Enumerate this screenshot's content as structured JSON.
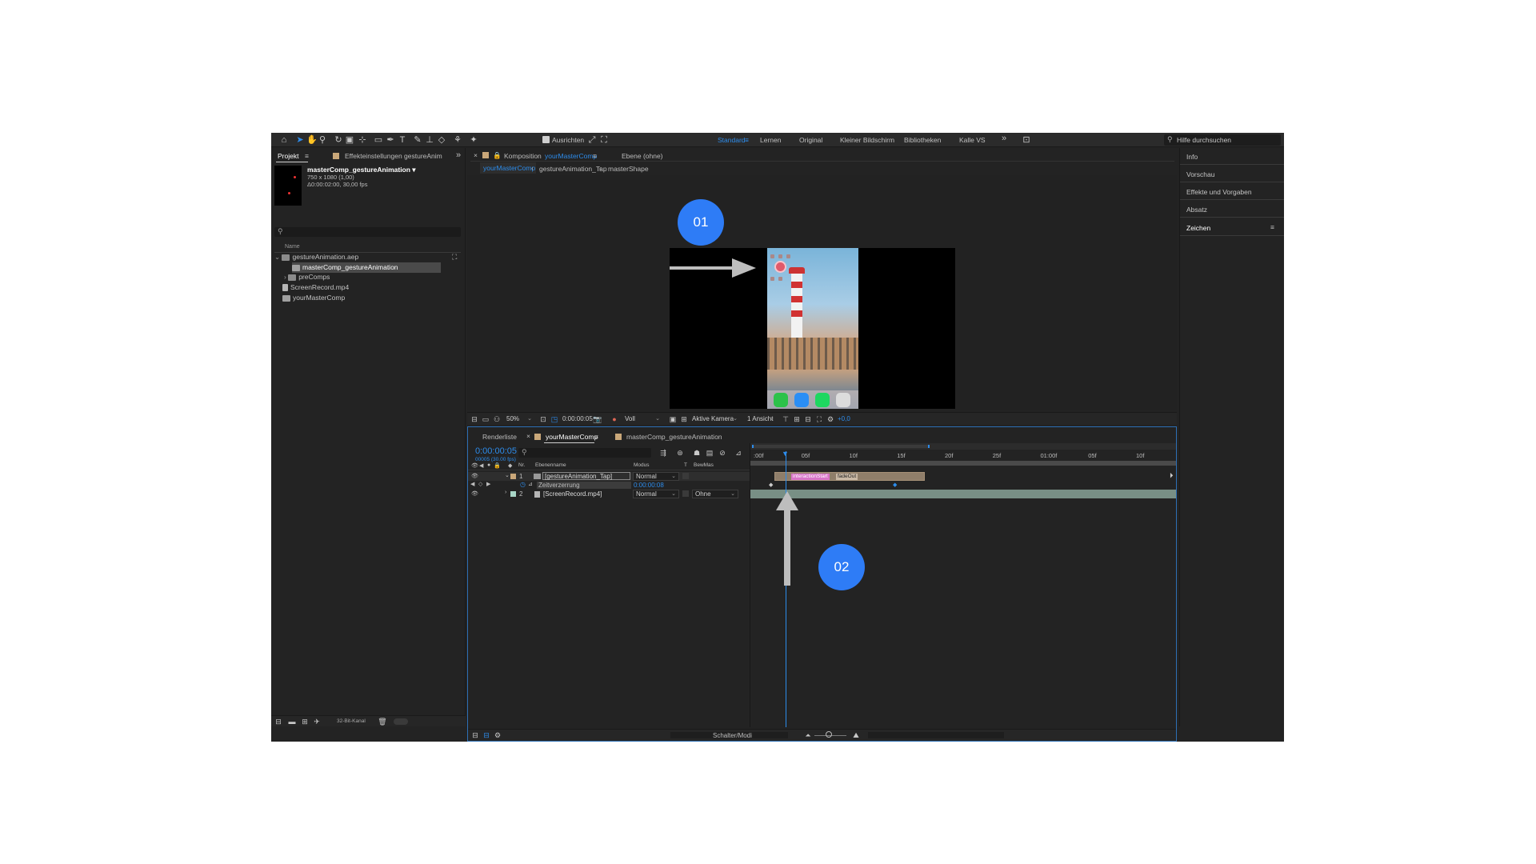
{
  "toolbar": {
    "align_label": "Ausrichten",
    "workspaces": [
      "Standard",
      "Lernen",
      "Original",
      "Kleiner Bildschirm",
      "Bibliotheken",
      "Kalle VS"
    ],
    "active_workspace": "Standard",
    "help_placeholder": "Hilfe durchsuchen"
  },
  "project_panel": {
    "tab_project": "Projekt",
    "tab_effects": "Effekteinstellungen gestureAnim",
    "selected_item": {
      "name": "masterComp_gestureAnimation ▾",
      "size": "750 x 1080 (1,00)",
      "duration": "Δ0:00:02:00, 30,00 fps"
    },
    "column_name": "Name",
    "tree": [
      {
        "label": "gestureAnimation.aep",
        "type": "folder",
        "indent": 0
      },
      {
        "label": "masterComp_gestureAnimation",
        "type": "comp",
        "indent": 2,
        "selected": true
      },
      {
        "label": "preComps",
        "type": "folder",
        "indent": 2
      },
      {
        "label": "ScreenRecord.mp4",
        "type": "file",
        "indent": 1
      },
      {
        "label": "yourMasterComp",
        "type": "comp",
        "indent": 1
      }
    ],
    "bit_depth": "32-Bit-Kanal"
  },
  "composition_panel": {
    "tab_prefix": "Komposition",
    "tab_comp": "yourMasterComp",
    "tab_layer": "Ebene (ohne)",
    "breadcrumbs": [
      "yourMasterComp",
      "gestureAnimation_Tap",
      "masterShape"
    ],
    "zoom": "50%",
    "timecode": "0:00:00:05",
    "resolution": "Voll",
    "camera": "Aktive Kamera",
    "views": "1 Ansicht",
    "exposure": "+0,0"
  },
  "annotations": {
    "badge1": "01",
    "badge2": "02"
  },
  "right_panel": {
    "items": [
      "Info",
      "Vorschau",
      "Effekte und Vorgaben",
      "Absatz",
      "Zeichen"
    ]
  },
  "timeline": {
    "tab_render": "Renderliste",
    "tab_comp": "yourMasterComp",
    "tab_master": "masterComp_gestureAnimation",
    "timecode": "0:00:00:05",
    "frame_info": "00005 (30.00 fps)",
    "col_nr": "Nr.",
    "col_layer": "Ebenenname",
    "col_mode": "Modus",
    "col_t": "T",
    "col_bewmas": "BewMas",
    "ruler": [
      ":00f",
      "05f",
      "10f",
      "15f",
      "20f",
      "25f",
      "01:00f",
      "05f",
      "10f"
    ],
    "layers": [
      {
        "nr": "1",
        "name": "[gestureAnimation_Tap]",
        "mode": "Normal",
        "bewmas": ""
      },
      {
        "nr": "2",
        "name": "[ScreenRecord.mp4]",
        "mode": "Normal",
        "bewmas": "Ohne"
      }
    ],
    "time_remap_label": "Zeitverzerrung",
    "time_remap_value": "0:00:00:08",
    "marker_start": "interactionStart",
    "marker_fade": "fadeOut",
    "switch_modes": "Schalter/Modi",
    "current_time_fraction": 0.17
  },
  "colors": {
    "accent": "#2d8ceb",
    "badge": "#2e7cf6",
    "marker": "#d874c8"
  }
}
